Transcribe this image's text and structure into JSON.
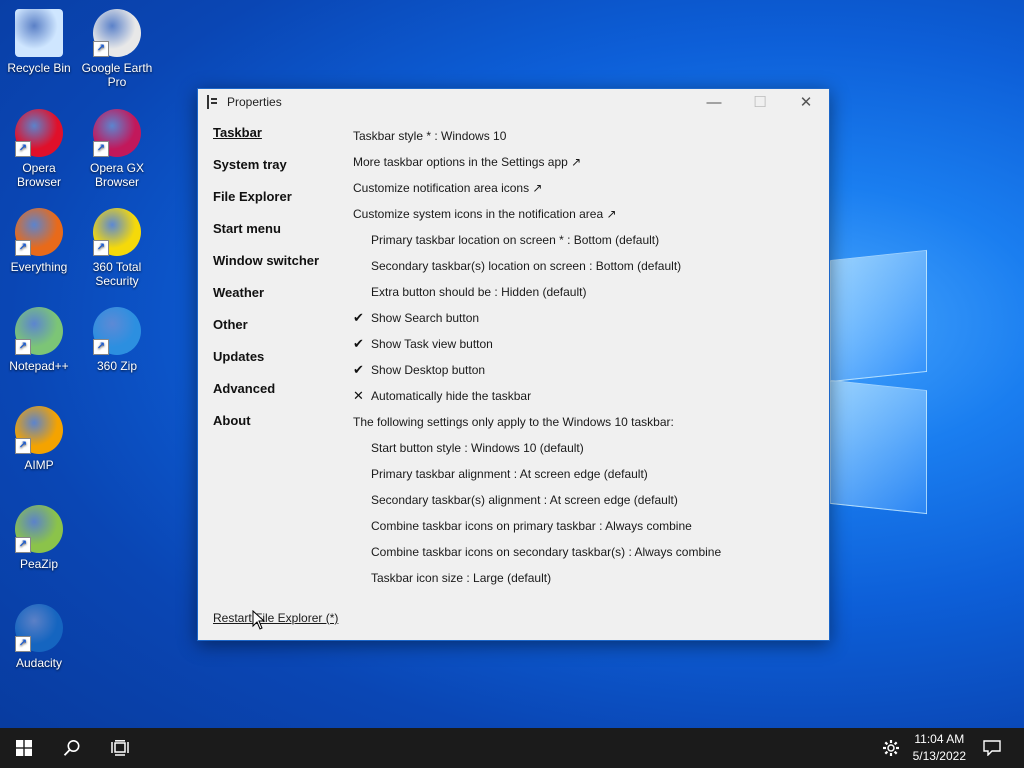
{
  "desktop": {
    "icons": [
      {
        "label": "Recycle Bin",
        "color": "#cfe6ff"
      },
      {
        "label": "Google Earth Pro",
        "color": "#e8e8e8",
        "badge": "Pro"
      },
      {
        "label": "Opera Browser",
        "color": "#e0102a"
      },
      {
        "label": "Opera GX Browser",
        "color": "#c2185b"
      },
      {
        "label": "Everything",
        "color": "#e86a1a"
      },
      {
        "label": "360 Total Security",
        "color": "#f5d90a"
      },
      {
        "label": "Notepad++",
        "color": "#7cc576"
      },
      {
        "label": "360 Zip",
        "color": "#2c8fe0"
      },
      {
        "label": "AIMP",
        "color": "#f4a300"
      },
      {
        "label": "PeaZip",
        "color": "#8bc34a"
      },
      {
        "label": "Audacity",
        "color": "#1565c0"
      }
    ]
  },
  "window": {
    "title": "Properties",
    "controls": {
      "minimize": "—",
      "maximize": "☐",
      "close": "✕"
    },
    "nav": [
      "Taskbar",
      "System tray",
      "File Explorer",
      "Start menu",
      "Window switcher",
      "Weather",
      "Other",
      "Updates",
      "Advanced",
      "About"
    ],
    "settings": [
      {
        "text": "Taskbar style * : Windows 10",
        "indent": false,
        "mark": ""
      },
      {
        "text": "More taskbar options in the Settings app ↗",
        "indent": false,
        "mark": ""
      },
      {
        "text": "Customize notification area icons ↗",
        "indent": false,
        "mark": ""
      },
      {
        "text": "Customize system icons in the notification area ↗",
        "indent": false,
        "mark": ""
      },
      {
        "text": "Primary taskbar location on screen * : Bottom (default)",
        "indent": true,
        "mark": ""
      },
      {
        "text": "Secondary taskbar(s) location on screen : Bottom (default)",
        "indent": true,
        "mark": ""
      },
      {
        "text": "Extra button should be : Hidden (default)",
        "indent": true,
        "mark": ""
      },
      {
        "text": "Show Search button",
        "indent": true,
        "mark": "✔"
      },
      {
        "text": "Show Task view button",
        "indent": true,
        "mark": "✔"
      },
      {
        "text": "Show Desktop button",
        "indent": true,
        "mark": "✔"
      },
      {
        "text": "Automatically hide the taskbar",
        "indent": true,
        "mark": "✕"
      },
      {
        "text": "The following settings only apply to the Windows 10 taskbar:",
        "indent": false,
        "mark": ""
      },
      {
        "text": "Start button style : Windows 10 (default)",
        "indent": true,
        "mark": ""
      },
      {
        "text": "Primary taskbar alignment : At screen edge (default)",
        "indent": true,
        "mark": ""
      },
      {
        "text": "Secondary taskbar(s) alignment : At screen edge (default)",
        "indent": true,
        "mark": ""
      },
      {
        "text": "Combine taskbar icons on primary taskbar : Always combine",
        "indent": true,
        "mark": ""
      },
      {
        "text": "Combine taskbar icons on secondary taskbar(s) : Always combine",
        "indent": true,
        "mark": ""
      },
      {
        "text": "Taskbar icon size : Large (default)",
        "indent": true,
        "mark": ""
      }
    ],
    "restart_label": "Restart File Explorer (*)"
  },
  "taskbar": {
    "time": "11:04 AM",
    "date": "5/13/2022"
  }
}
